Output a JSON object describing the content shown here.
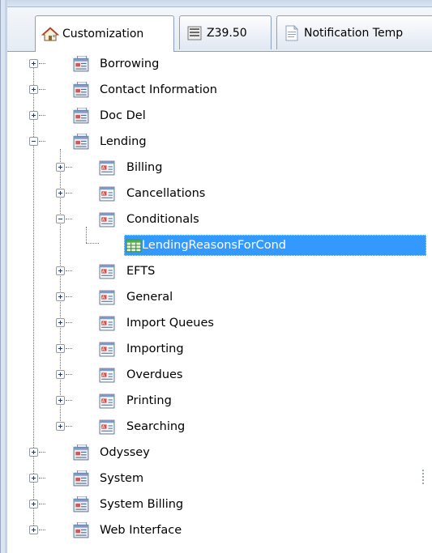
{
  "tabs": [
    {
      "label": "Customization",
      "icon": "home-icon",
      "active": true
    },
    {
      "label": "Z39.50",
      "icon": "list-icon",
      "active": false
    },
    {
      "label": "Notification Temp",
      "icon": "document-icon",
      "active": false
    }
  ],
  "tree": {
    "borrowing": "Borrowing",
    "contact_information": "Contact Information",
    "doc_del": "Doc Del",
    "lending": "Lending",
    "lending_children": {
      "billing": "Billing",
      "cancellations": "Cancellations",
      "conditionals": "Conditionals",
      "conditionals_child": "LendingReasonsForCond",
      "efts": "EFTS",
      "general": "General",
      "import_queues": "Import Queues",
      "importing": "Importing",
      "overdues": "Overdues",
      "printing": "Printing",
      "searching": "Searching"
    },
    "odyssey": "Odyssey",
    "system": "System",
    "system_billing": "System Billing",
    "web_interface": "Web Interface"
  },
  "colors": {
    "selection": "#3399ff",
    "tab_border": "#8fa1ba"
  }
}
